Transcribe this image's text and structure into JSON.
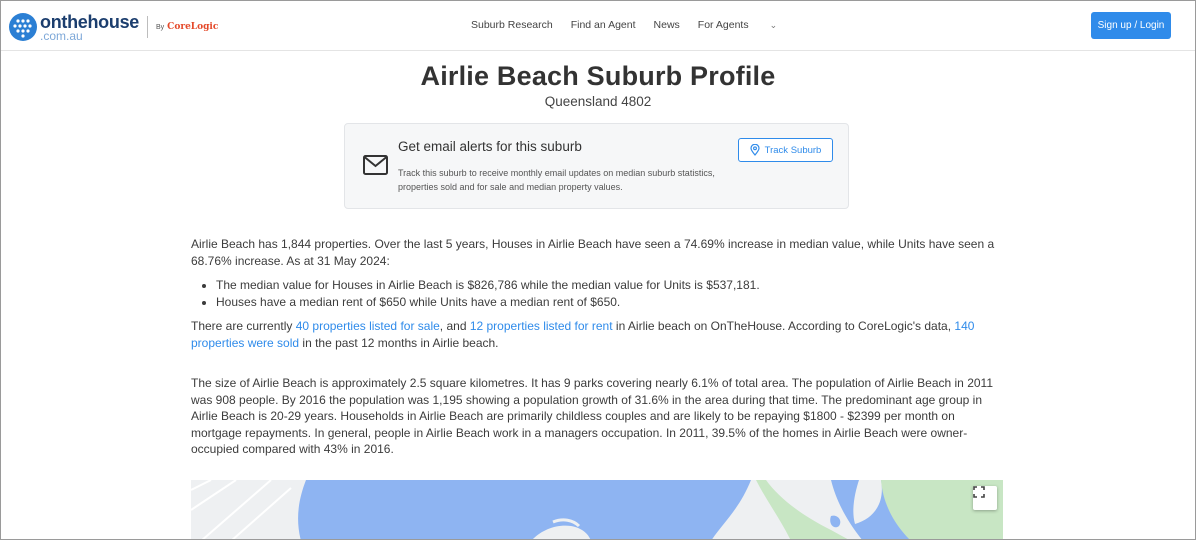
{
  "header": {
    "logo_main": "onthehouse",
    "logo_sub": ".com.au",
    "by_label": "By",
    "by_brand": "CoreLogic",
    "nav": [
      "Suburb Research",
      "Find an Agent",
      "News",
      "For Agents"
    ],
    "signup_label": "Sign up / Login"
  },
  "page": {
    "title": "Airlie Beach Suburb Profile",
    "subtitle": "Queensland 4802"
  },
  "alert": {
    "heading": "Get email alerts for this suburb",
    "description": "Track this suburb to receive monthly email updates on median suburb statistics, properties sold and for sale and median property values.",
    "button_label": "Track Suburb"
  },
  "content": {
    "intro": "Airlie Beach has 1,844 properties. Over the last 5 years, Houses in Airlie Beach have seen a 74.69% increase in median value, while Units have seen a 68.76% increase. As at 31 May 2024:",
    "bullets": [
      "The median value for Houses in Airlie Beach is $826,786 while the median value for Units is $537,181.",
      "Houses have a median rent of $650 while Units have a median rent of $650."
    ],
    "p2_a": "There are currently ",
    "p2_link1": "40 properties listed for sale",
    "p2_b": ", and ",
    "p2_link2": "12 properties listed for rent",
    "p2_c": " in Airlie beach on OnTheHouse. According to CoreLogic's data, ",
    "p2_link3": "140 properties were sold",
    "p2_d": " in the past 12 months in Airlie beach.",
    "p3": "The size of Airlie Beach is approximately 2.5 square kilometres. It has 9 parks covering nearly 6.1% of total area. The population of Airlie Beach in 2011 was 908 people. By 2016 the population was 1,195 showing a population growth of 31.6% in the area during that time. The predominant age group in Airlie Beach is 20-29 years. Households in Airlie Beach are primarily childless couples and are likely to be repaying $1800 - $2399 per month on mortgage repayments. In general, people in Airlie Beach work in a managers occupation. In 2011, 39.5% of the homes in Airlie Beach were owner-occupied compared with 43% in 2016."
  },
  "colors": {
    "accent": "#2f8bea",
    "link": "#2f8bea",
    "water": "#8eb4f2",
    "land": "#eef0f2",
    "park": "#c8e6c4"
  },
  "icons": {
    "mail": "mail-icon",
    "pin": "map-pin-icon",
    "fullscreen": "fullscreen-icon",
    "chevron": "chevron-down-icon"
  }
}
